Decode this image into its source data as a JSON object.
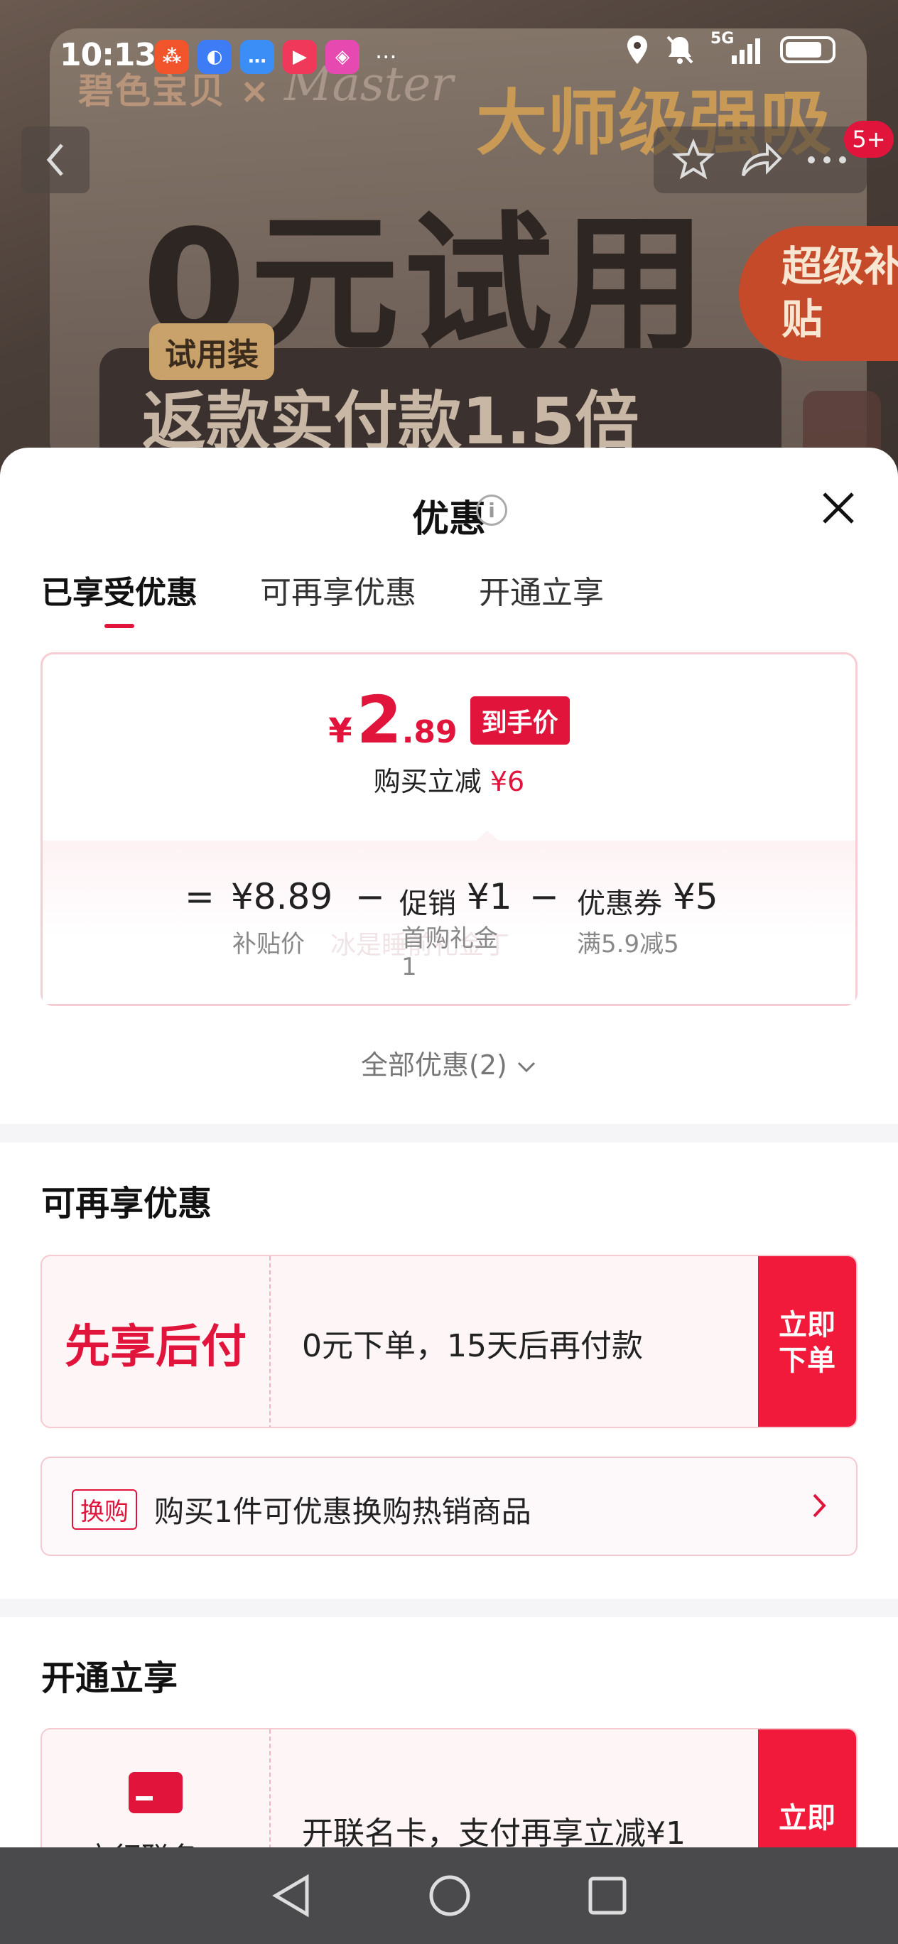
{
  "status_bar": {
    "time": "10:13",
    "app_icons": [
      {
        "name": "orange-app-icon",
        "color": "#f2552c",
        "glyph": "⁂"
      },
      {
        "name": "blue-app-icon",
        "color": "#3d7cf5",
        "glyph": "◐"
      },
      {
        "name": "message-app-icon",
        "color": "#3a8ef6",
        "glyph": "…"
      },
      {
        "name": "video-app-icon",
        "color": "#f0385a",
        "glyph": "▶"
      },
      {
        "name": "vip-app-icon",
        "color": "#e64ab0",
        "glyph": "◈"
      }
    ],
    "more": "···",
    "network": "5G"
  },
  "background": {
    "brand": "碧色宝贝 ×",
    "brand2": "Master",
    "headline": "大师级强吸",
    "zero": "0元试用",
    "trial_tag": "试用装",
    "refund": "返款实付款1.5倍",
    "subsidy": "超级补贴",
    "badge": "5+"
  },
  "sheet": {
    "title": "优惠",
    "tabs": [
      "已享受优惠",
      "可再享优惠",
      "开通立享"
    ],
    "price": {
      "currency": "¥",
      "int": "2",
      "dec": ".89",
      "tag": "到手价",
      "reduce_label": "购买立减",
      "reduce_value": "¥6"
    },
    "breakdown": {
      "eq": "=",
      "val1": "¥8.89",
      "sub1": "补贴价",
      "minus": "−",
      "label2": "促销",
      "val2": "¥1",
      "sub2_line1": "首购礼金",
      "sub2_line2": "1",
      "sub2_ghost": "冰是睡前礼金丁",
      "label3": "优惠券",
      "val3": "¥5",
      "sub3": "满5.9减5"
    },
    "all_offers": "全部优惠(2)",
    "more_section": {
      "title": "可再享优惠",
      "bnpl_label": "先享后付",
      "bnpl_text": "0元下单，15天后再付款",
      "bnpl_btn": "立即下单",
      "swap_tag": "换购",
      "swap_text": "购买1件可优惠换购热销商品"
    },
    "open_section": {
      "title": "开通立享",
      "card_label": "交行联名",
      "card_text": "开联名卡，支付再享立减¥1",
      "card_btn": "立即"
    }
  },
  "colors": {
    "accent": "#e1143c",
    "nav_bar": "#4a4a4c"
  }
}
